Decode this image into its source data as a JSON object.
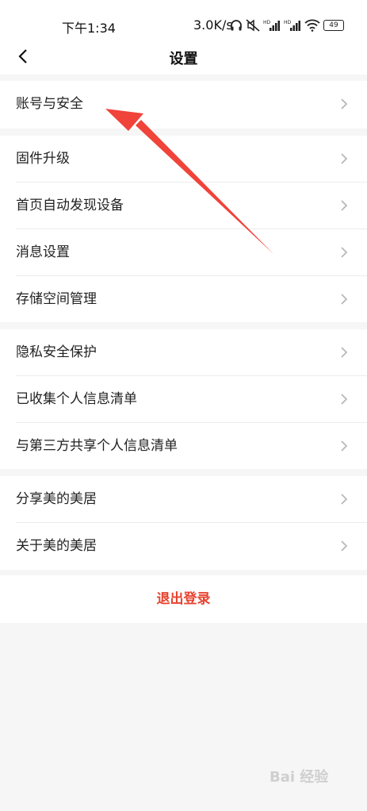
{
  "status": {
    "time": "下午1:34",
    "speed": "3.0K/s",
    "battery": "49"
  },
  "header": {
    "title": "设置"
  },
  "groups": [
    {
      "items": [
        {
          "label": "账号与安全"
        }
      ]
    },
    {
      "items": [
        {
          "label": "固件升级"
        },
        {
          "label": "首页自动发现设备"
        },
        {
          "label": "消息设置"
        },
        {
          "label": "存储空间管理"
        }
      ]
    },
    {
      "items": [
        {
          "label": "隐私安全保护"
        },
        {
          "label": "已收集个人信息清单"
        },
        {
          "label": "与第三方共享个人信息清单"
        }
      ]
    },
    {
      "items": [
        {
          "label": "分享美的美居"
        },
        {
          "label": "关于美的美居"
        }
      ]
    }
  ],
  "logout": {
    "label": "退出登录"
  },
  "watermark": {
    "text": "Bai 经验"
  },
  "colors": {
    "accent": "#e8432e",
    "annotation_arrow": "#f0433a"
  },
  "icons": [
    "back-icon",
    "headphones-icon",
    "mute-icon",
    "signal-icon",
    "wifi-icon",
    "battery-icon",
    "chevron-right-icon"
  ]
}
